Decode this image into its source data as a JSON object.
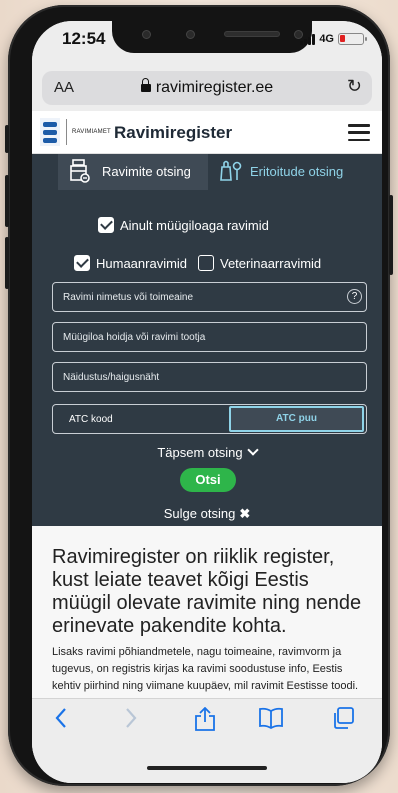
{
  "status_bar": {
    "time": "12:54",
    "network": "4G"
  },
  "browser": {
    "text_size_label": "AA",
    "url": "ravimiregister.ee",
    "reload_icon": "reload-icon"
  },
  "site_header": {
    "agency": "RAVIMIAMET",
    "brand": "Ravimiregister",
    "menu_icon": "hamburger-menu-icon"
  },
  "search": {
    "tabs": [
      {
        "label": "Ravimite otsing",
        "icon": "medicine-box-icon",
        "active": true
      },
      {
        "label": "Eritoitude otsing",
        "icon": "baby-bottle-icon",
        "active": false
      }
    ],
    "only_marketed_label": "Ainult müügiloaga ravimid",
    "only_marketed_checked": true,
    "human_label": "Humaanravimid",
    "human_checked": true,
    "veterinary_label": "Veterinaarravimid",
    "veterinary_checked": false,
    "name_placeholder": "Ravimi nimetus või toimeaine",
    "holder_placeholder": "Müügiloa hoidja või ravimi tootja",
    "indication_placeholder": "Näidustus/haigusnäht",
    "atc_label": "ATC kood",
    "atc_tree_button": "ATC puu",
    "advanced_label": "Täpsem otsing",
    "submit_label": "Otsi",
    "close_label": "Sulge otsing",
    "accent_color": "#8fd3e8",
    "submit_color": "#2eb54a",
    "panel_color": "#2f3a44"
  },
  "content": {
    "headline": "Ravimiregister on riiklik register, kust leiate teavet kõigi Eestis müügil olevate ravimite ning nende erinevate pakendite kohta.",
    "paragraph": "Lisaks ravimi põhiandmetele, nagu toimeaine, ravimvorm ja tugevus, on registris kirjas ka ravimi soodustuse info, Eestis kehtiv piirhind ning viimane kuupäev, mil ravimit Eestisse toodi. Müügiloaga ravimite juurde on lisatud ravimi"
  },
  "toolbar": {
    "items": [
      "back-icon",
      "forward-icon",
      "share-icon",
      "bookmarks-icon",
      "tabs-icon"
    ]
  }
}
